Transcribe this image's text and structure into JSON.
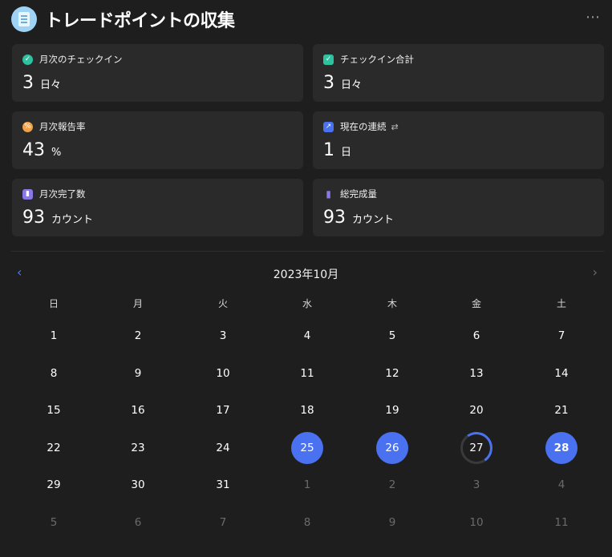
{
  "header": {
    "title": "トレードポイントの収集",
    "more_icon": "⋯",
    "app_icon": "document-icon"
  },
  "cards": [
    {
      "label": "月次のチェックイン",
      "value": "3",
      "unit": "日々",
      "icon": "shield-check-icon",
      "icon_color": "#2fc2a1",
      "icon_glyph": "✓"
    },
    {
      "label": "チェックイン合計",
      "value": "3",
      "unit": "日々",
      "icon": "calendar-check-icon",
      "icon_color": "#2fc2a1",
      "icon_glyph": "✓"
    },
    {
      "label": "月次報告率",
      "value": "43",
      "unit": "%",
      "icon": "percent-icon",
      "icon_color": "#f0a24a",
      "icon_glyph": "%"
    },
    {
      "label": "現在の連続",
      "value": "1",
      "unit": "日",
      "icon": "trend-icon",
      "icon_color": "#4a72f0",
      "icon_glyph": "↗",
      "extra": "⇄"
    },
    {
      "label": "月次完了数",
      "value": "93",
      "unit": "カウント",
      "icon": "bar-chart-icon",
      "icon_color": "#8a78e6",
      "icon_glyph": "▮"
    },
    {
      "label": "総完成量",
      "value": "93",
      "unit": "カウント",
      "icon": "bars-rising-icon",
      "icon_color": "#8a78e6",
      "icon_glyph": "▮"
    }
  ],
  "calendar": {
    "month_label": "2023年10月",
    "prev": "‹",
    "next": "›",
    "weekdays": [
      "日",
      "月",
      "火",
      "水",
      "木",
      "金",
      "土"
    ],
    "weeks": [
      [
        "1",
        "2",
        "3",
        "4",
        "5",
        "6",
        "7"
      ],
      [
        "8",
        "9",
        "10",
        "11",
        "12",
        "13",
        "14"
      ],
      [
        "15",
        "16",
        "17",
        "18",
        "19",
        "20",
        "21"
      ],
      [
        "22",
        "23",
        "24",
        "25",
        "26",
        "27",
        "28"
      ],
      [
        "29",
        "30",
        "31",
        "1",
        "2",
        "3",
        "4"
      ],
      [
        "5",
        "6",
        "7",
        "8",
        "9",
        "10",
        "11"
      ]
    ],
    "checked_days": [
      "25",
      "26",
      "28"
    ],
    "today": "27",
    "accent": "#4a72f0"
  }
}
